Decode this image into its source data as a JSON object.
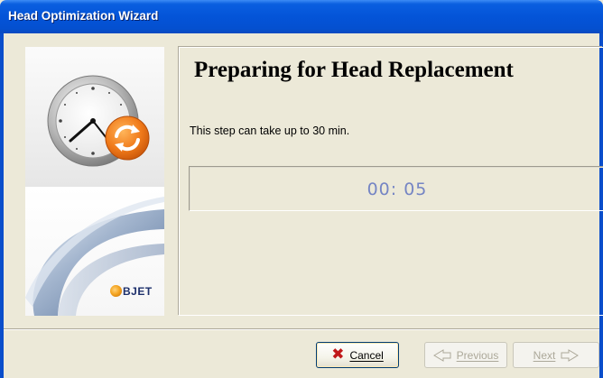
{
  "window": {
    "title": "Head Optimization Wizard"
  },
  "sidebar": {
    "logo_text": "BJET",
    "clock_icon": "clock-icon",
    "sync_icon": "sync-icon"
  },
  "main": {
    "title": "Preparing for Head Replacement",
    "note": "This step can take up to 30 min.",
    "timer": "00: 05"
  },
  "buttons": {
    "cancel": {
      "label": "Cancel",
      "icon": "x-icon",
      "enabled": true
    },
    "previous": {
      "label": "Previous",
      "icon": "arrow-left-icon",
      "enabled": false
    },
    "next": {
      "label": "Next",
      "icon": "arrow-right-icon",
      "enabled": false
    }
  },
  "colors": {
    "titlebar": "#0454d8",
    "timer_text": "#7585c4",
    "cancel_icon": "#c0181a",
    "sync_orange": "#f07a1a"
  }
}
